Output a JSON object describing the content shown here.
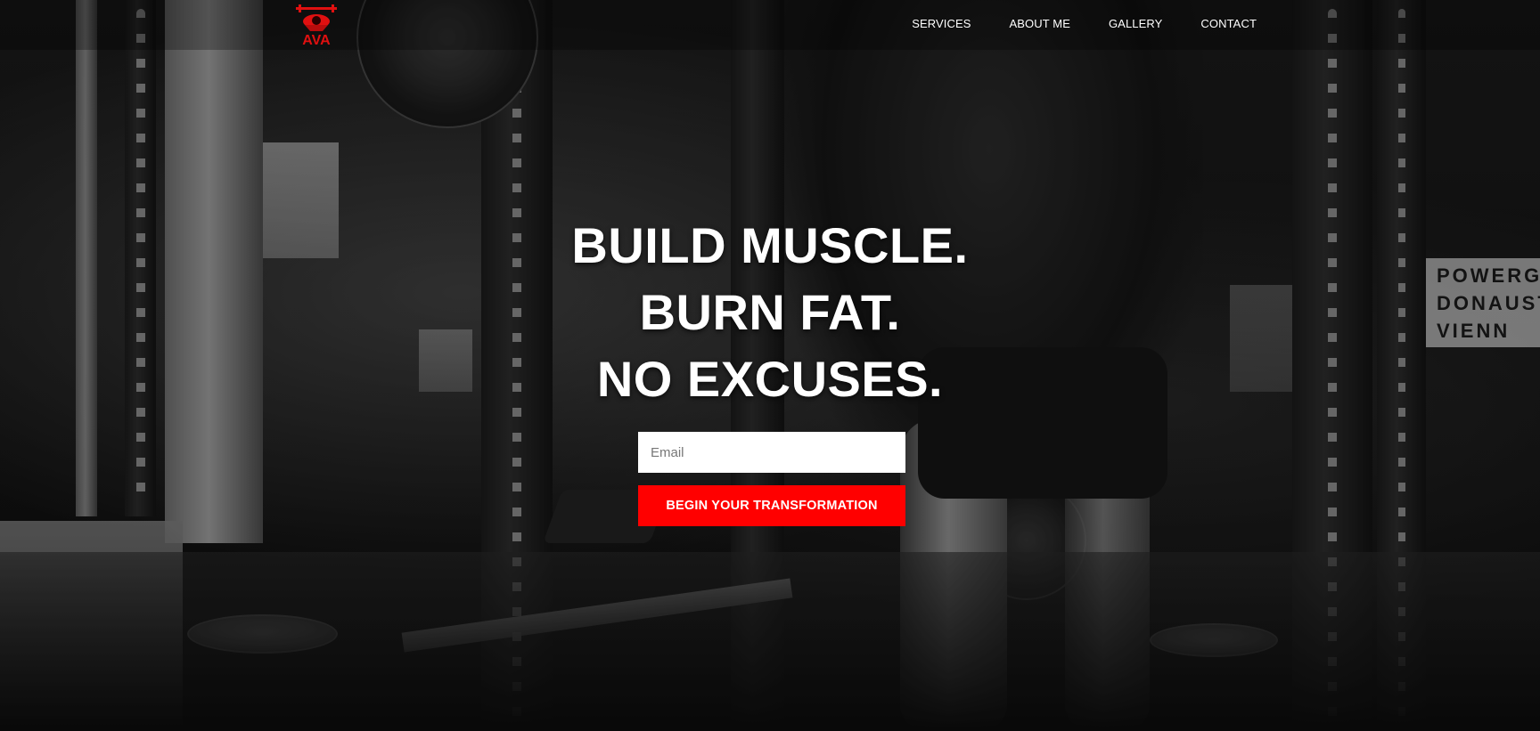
{
  "brand": {
    "logo_text": "AVA",
    "logo_color": "#e01010"
  },
  "nav": {
    "items": [
      {
        "label": "SERVICES"
      },
      {
        "label": "ABOUT ME"
      },
      {
        "label": "GALLERY"
      },
      {
        "label": "CONTACT"
      }
    ]
  },
  "hero": {
    "headline_lines": [
      "BUILD MUSCLE.",
      "BURN FAT.",
      "NO EXCUSES."
    ],
    "email_placeholder": "Email",
    "cta_label": "BEGIN YOUR TRANSFORMATION",
    "cta_color": "#ff0000",
    "background_sign_lines": [
      "POWERGY",
      "DONAUSTA",
      "VIENN"
    ]
  }
}
